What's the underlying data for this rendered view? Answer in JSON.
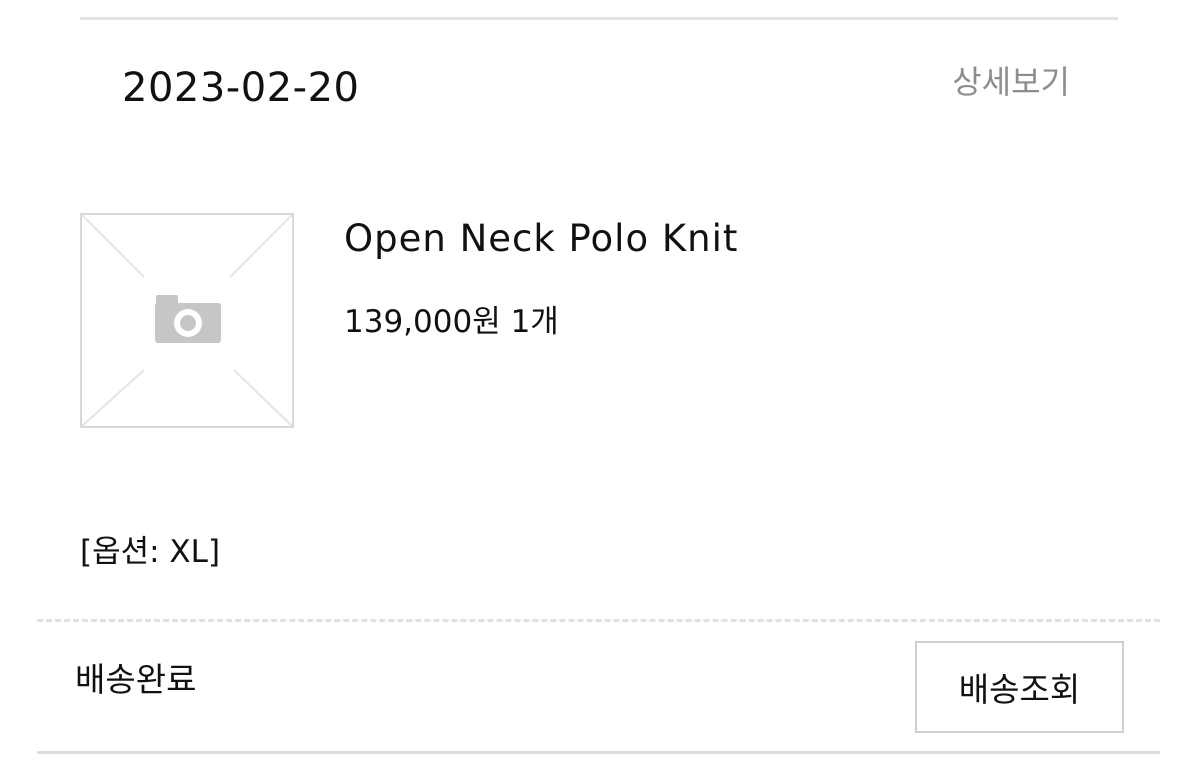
{
  "order": {
    "date": "2023-02-20",
    "detail_link": "상세보기"
  },
  "product": {
    "thumbnail_icon": "camera-placeholder-icon",
    "name": "Open Neck Polo Knit",
    "price_qty": "139,000원 1개",
    "option": "[옵션: XL]"
  },
  "shipping": {
    "status": "배송완료",
    "track_button": "배송조회"
  }
}
